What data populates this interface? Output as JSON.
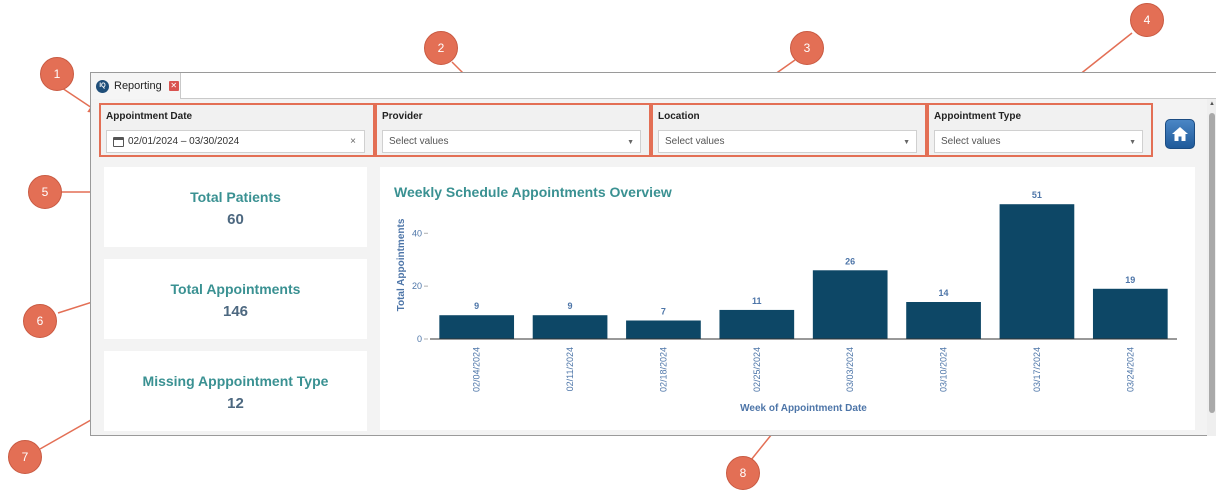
{
  "tab": {
    "label": "Reporting",
    "logo": "IQ"
  },
  "filters": {
    "appointment_date": {
      "label": "Appointment Date",
      "value": "02/01/2024 – 03/30/2024"
    },
    "provider": {
      "label": "Provider",
      "placeholder": "Select values"
    },
    "location": {
      "label": "Location",
      "placeholder": "Select values"
    },
    "appointment_type": {
      "label": "Appointment Type",
      "placeholder": "Select values"
    }
  },
  "kpis": {
    "total_patients": {
      "title": "Total Patients",
      "value": "60"
    },
    "total_appointments": {
      "title": "Total Appointments",
      "value": "146"
    },
    "missing_type": {
      "title": "Missing Apppointment Type",
      "value": "12"
    }
  },
  "callouts": [
    "1",
    "2",
    "3",
    "4",
    "5",
    "6",
    "7",
    "8"
  ],
  "colors": {
    "accent": "#e36f55",
    "bar": "#0d4766",
    "kpi_title": "#3a9192",
    "axis_text": "#4d75a8"
  },
  "chart_data": {
    "type": "bar",
    "title": "Weekly Schedule Appointments Overview",
    "xlabel": "Week of Appointment Date",
    "ylabel": "Total Appointments",
    "categories": [
      "02/04/2024",
      "02/11/2024",
      "02/18/2024",
      "02/25/2024",
      "03/03/2024",
      "03/10/2024",
      "03/17/2024",
      "03/24/2024"
    ],
    "values": [
      9,
      9,
      7,
      11,
      26,
      14,
      51,
      19
    ],
    "yticks": [
      0,
      20,
      40
    ],
    "ylim": [
      0,
      56
    ],
    "data_labels": true,
    "grid": false
  }
}
